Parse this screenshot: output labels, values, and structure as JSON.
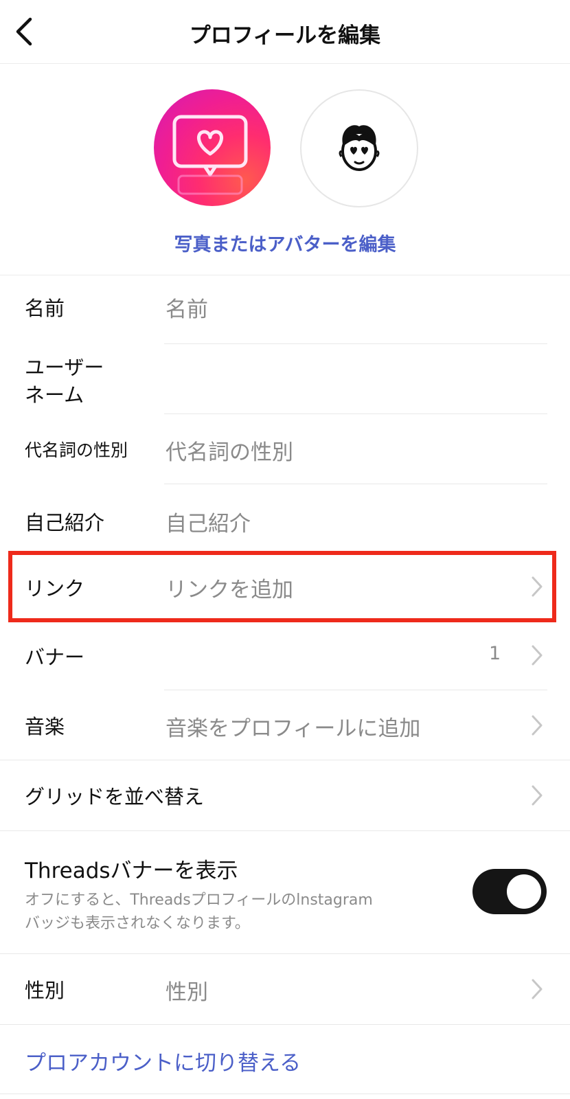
{
  "header": {
    "title": "プロフィールを編集"
  },
  "avatar_section": {
    "edit_label": "写真またはアバターを編集"
  },
  "fields": {
    "name": {
      "label": "名前",
      "placeholder": "名前"
    },
    "username": {
      "label_line1": "ユーザー",
      "label_line2": "ネーム"
    },
    "pronouns": {
      "label": "代名詞の性別",
      "placeholder": "代名詞の性別"
    },
    "bio": {
      "label": "自己紹介",
      "placeholder": "自己紹介"
    },
    "links": {
      "label": "リンク",
      "placeholder": "リンクを追加"
    },
    "banner": {
      "label": "バナー",
      "count": "1"
    },
    "music": {
      "label": "音楽",
      "placeholder": "音楽をプロフィールに追加"
    },
    "grid": {
      "label": "グリッドを並べ替え"
    },
    "gender": {
      "label": "性別",
      "placeholder": "性別"
    }
  },
  "threads": {
    "title": "Threadsバナーを表示",
    "description_line1": "オフにすると、Threadsプロフィールのlnstagram",
    "description_line2": "バッジも表示されなくなります。",
    "enabled": true
  },
  "pro_account": {
    "label": "プロアカウントに切り替える"
  },
  "colors": {
    "accent": "#4b5fc8",
    "highlight": "#ee2a1b",
    "toggle": "#151515"
  },
  "icons": {
    "back": "chevron-left-icon",
    "avatar_photo": "neon-heart-message-icon",
    "avatar_icon": "avatar-face-icon",
    "chevron": "chevron-right-icon"
  }
}
